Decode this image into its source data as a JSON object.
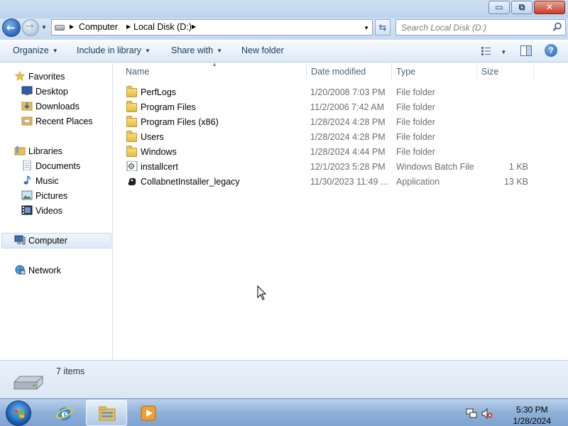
{
  "window": {
    "controls": {
      "minimize": "▭",
      "restore": "⧉",
      "close": "✕"
    }
  },
  "navigation": {
    "back_icon": "back-arrow-icon",
    "forward_icon": "forward-arrow-icon",
    "breadcrumbs": [
      "Computer",
      "Local Disk (D:)"
    ],
    "search_placeholder": "Search Local Disk (D:)"
  },
  "toolbar": {
    "organize": "Organize",
    "include_in_library": "Include in library",
    "share_with": "Share with",
    "new_folder": "New folder"
  },
  "sidebar": {
    "favorites": {
      "label": "Favorites",
      "items": [
        "Desktop",
        "Downloads",
        "Recent Places"
      ]
    },
    "libraries": {
      "label": "Libraries",
      "items": [
        "Documents",
        "Music",
        "Pictures",
        "Videos"
      ]
    },
    "computer": "Computer",
    "network": "Network"
  },
  "columns": [
    "Name",
    "Date modified",
    "Type",
    "Size"
  ],
  "files": [
    {
      "name": "PerfLogs",
      "date": "1/20/2008 7:03 PM",
      "type": "File folder",
      "size": "",
      "icon": "folder-icon"
    },
    {
      "name": "Program Files",
      "date": "11/2/2006 7:42 AM",
      "type": "File folder",
      "size": "",
      "icon": "folder-icon"
    },
    {
      "name": "Program Files (x86)",
      "date": "1/28/2024 4:28 PM",
      "type": "File folder",
      "size": "",
      "icon": "folder-icon"
    },
    {
      "name": "Users",
      "date": "1/28/2024 4:28 PM",
      "type": "File folder",
      "size": "",
      "icon": "folder-icon"
    },
    {
      "name": "Windows",
      "date": "1/28/2024 4:44 PM",
      "type": "File folder",
      "size": "",
      "icon": "folder-icon"
    },
    {
      "name": "installcert",
      "date": "12/1/2023 5:28 PM",
      "type": "Windows Batch File",
      "size": "1 KB",
      "icon": "batch-file-icon"
    },
    {
      "name": "CollabnetInstaller_legacy",
      "date": "11/30/2023 11:49 ...",
      "type": "Application",
      "size": "13 KB",
      "icon": "application-icon"
    }
  ],
  "details": {
    "item_count": "7 items"
  },
  "taskbar": {
    "time": "5:30 PM",
    "date": "1/28/2024"
  },
  "colors": {
    "accent": "#1e395b",
    "selection": "#dde8f5",
    "folder": "#e6b93f"
  }
}
